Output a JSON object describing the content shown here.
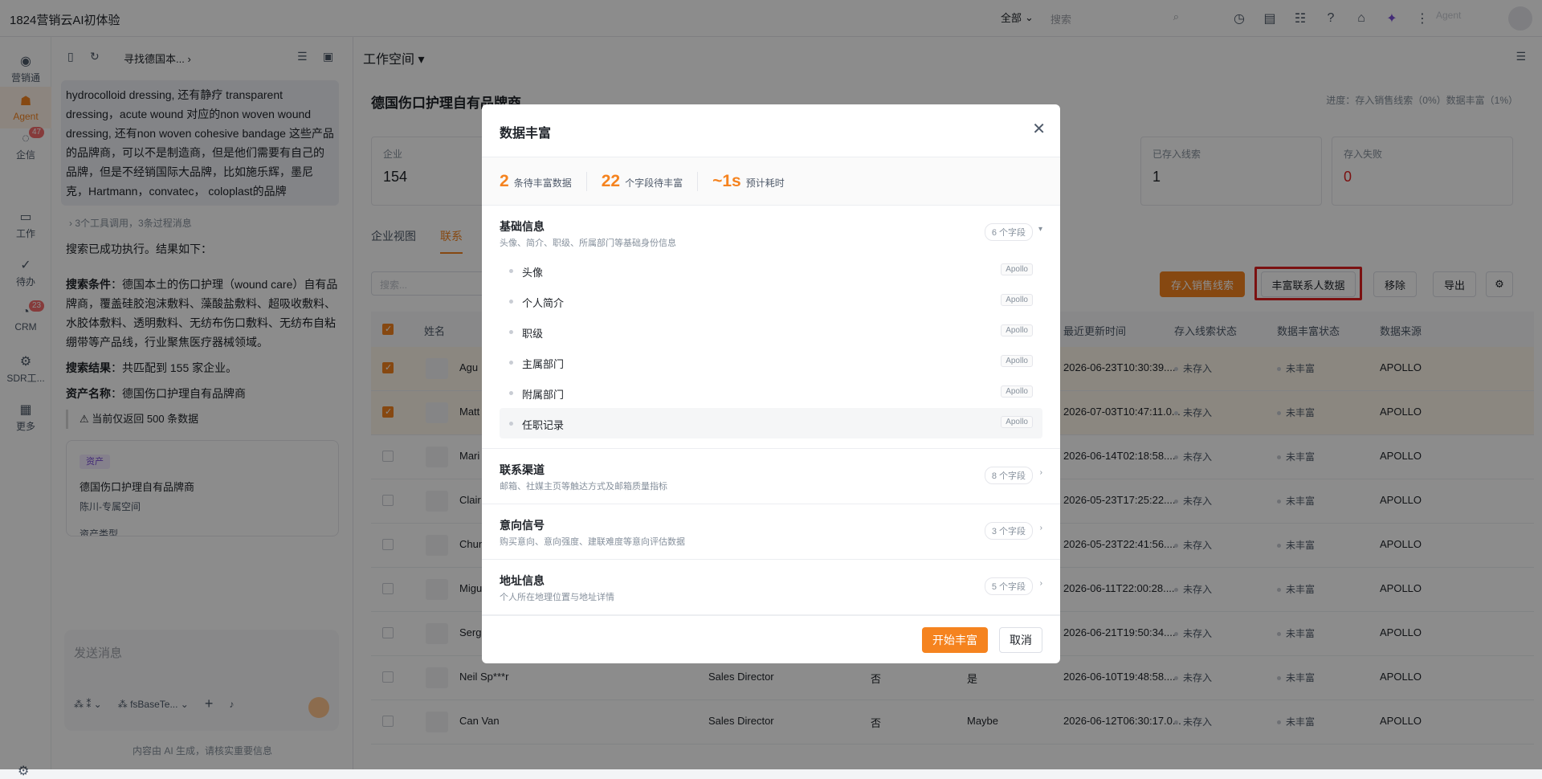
{
  "app": {
    "title": "1824营销云AI初体验",
    "scope": "全部",
    "search_placeholder": "搜索",
    "agent_label": "Agent"
  },
  "rail": [
    {
      "label": "营销通",
      "icon": "broadcast-icon"
    },
    {
      "label": "Agent",
      "icon": "robot-icon"
    },
    {
      "label": "企信",
      "icon": "chat-icon",
      "badge": "47"
    },
    {
      "label": "工作",
      "icon": "briefcase-icon"
    },
    {
      "label": "待办",
      "icon": "check-circle-icon"
    },
    {
      "label": "CRM",
      "icon": "crm-icon",
      "badge": "23"
    },
    {
      "label": "SDR工...",
      "icon": "sdr-icon"
    },
    {
      "label": "更多",
      "icon": "grid-icon"
    }
  ],
  "tooltip": "工作",
  "chat": {
    "breadcrumb": "寻找德国本...",
    "user_msg": "hydrocolloid dressing, 还有静疗 transparent dressing，acute wound 对应的non woven wound dressing, 还有non woven cohesive bandage 这些产品的品牌商，可以不是制造商，但是他们需要有自己的品牌，但是不经销国际大品牌，比如施乐辉，墨尼克，Hartmann，convatec， coloplast的品牌",
    "tool_line": "3个工具调用，3条过程消息",
    "result_intro": "搜索已成功执行。结果如下：",
    "cond_label": "搜索条件",
    "cond_text": "：德国本土的伤口护理（wound care）自有品牌商，覆盖硅胶泡沫敷料、藻酸盐敷料、超吸收敷料、水胶体敷料、透明敷料、无纺布伤口敷料、无纺布自粘绷带等产品线，行业聚焦医疗器械领域。",
    "res_label": "搜索结果",
    "res_text": "：共匹配到 155 家企业。",
    "asset_label": "资产名称",
    "asset_text": "：德国伤口护理自有品牌商",
    "warn": "⚠ 当前仅返回 500 条数据",
    "card": {
      "tag": "资产",
      "title": "德国伤口护理自有品牌商",
      "sub": "陈川-专属空间",
      "extra": "资产类型"
    },
    "input_placeholder": "发送消息",
    "tool_a": "⁂ ⁑",
    "tool_b": "fsBaseTe...",
    "disclaimer": "内容由 AI 生成，请核实重要信息"
  },
  "main": {
    "workspace": "工作空间",
    "title": "德国伤口护理自有品牌商",
    "progress": "进度：存入销售线索（0%）数据丰富（1%）",
    "stats": [
      {
        "label": "企业",
        "value": "154"
      },
      {
        "label": "已存入线索",
        "value": "1"
      },
      {
        "label": "存入失败",
        "value": "0"
      }
    ],
    "tabs": [
      "企业视图",
      "联系"
    ],
    "filter_placeholder": "搜索...",
    "buttons": {
      "save": "存入销售线索",
      "enrich": "丰富联系人数据",
      "remove": "移除",
      "export": "导出"
    },
    "columns": {
      "name": "姓名",
      "updated": "最近更新时间",
      "save_status": "存入线索状态",
      "enrich_status": "数据丰富状态",
      "source": "数据来源"
    },
    "rows": [
      {
        "name": "Agu",
        "title": "",
        "c1": "",
        "c2": "",
        "time": "2026-06-23T10:30:39....",
        "save": "未存入",
        "enrich": "未丰富",
        "src": "APOLLO",
        "checked": true
      },
      {
        "name": "Matt",
        "title": "",
        "c1": "",
        "c2": "",
        "time": "2026-07-03T10:47:11.0...",
        "save": "未存入",
        "enrich": "未丰富",
        "src": "APOLLO",
        "checked": true
      },
      {
        "name": "Mari",
        "title": "",
        "c1": "",
        "c2": "",
        "time": "2026-06-14T02:18:58....",
        "save": "未存入",
        "enrich": "未丰富",
        "src": "APOLLO",
        "checked": false
      },
      {
        "name": "Clair",
        "title": "",
        "c1": "",
        "c2": "",
        "time": "2026-05-23T17:25:22....",
        "save": "未存入",
        "enrich": "未丰富",
        "src": "APOLLO",
        "checked": false
      },
      {
        "name": "Chun",
        "title": "",
        "c1": "",
        "c2": "",
        "time": "2026-05-23T22:41:56....",
        "save": "未存入",
        "enrich": "未丰富",
        "src": "APOLLO",
        "checked": false
      },
      {
        "name": "Migu",
        "title": "",
        "c1": "",
        "c2": "",
        "time": "2026-06-11T22:00:28....",
        "save": "未存入",
        "enrich": "未丰富",
        "src": "APOLLO",
        "checked": false
      },
      {
        "name": "Serg",
        "title": "",
        "c1": "",
        "c2": "",
        "time": "2026-06-21T19:50:34....",
        "save": "未存入",
        "enrich": "未丰富",
        "src": "APOLLO",
        "checked": false
      },
      {
        "name": "Neil Sp***r",
        "title": "Sales Director",
        "c1": "否",
        "c2": "是",
        "time": "2026-06-10T19:48:58....",
        "save": "未存入",
        "enrich": "未丰富",
        "src": "APOLLO",
        "checked": false
      },
      {
        "name": "Can Van",
        "title": "Sales Director",
        "c1": "否",
        "c2": "Maybe",
        "time": "2026-06-12T06:30:17.0...",
        "save": "未存入",
        "enrich": "未丰富",
        "src": "APOLLO",
        "checked": false
      }
    ]
  },
  "modal": {
    "title": "数据丰富",
    "stats": [
      {
        "value": "2",
        "label": "条待丰富数据"
      },
      {
        "value": "22",
        "label": "个字段待丰富"
      },
      {
        "value": "~1s",
        "label": "预计耗时"
      }
    ],
    "sections": [
      {
        "title": "基础信息",
        "desc": "头像、简介、职级、所属部门等基础身份信息",
        "count": "6 个字段",
        "arrow": "▾",
        "fields": [
          "头像",
          "个人简介",
          "职级",
          "主属部门",
          "附属部门",
          "任职记录"
        ],
        "source": "Apollo"
      },
      {
        "title": "联系渠道",
        "desc": "邮箱、社媒主页等触达方式及邮箱质量指标",
        "count": "8 个字段",
        "arrow": "›"
      },
      {
        "title": "意向信号",
        "desc": "购买意向、意向强度、建联难度等意向评估数据",
        "count": "3 个字段",
        "arrow": "›"
      },
      {
        "title": "地址信息",
        "desc": "个人所在地理位置与地址详情",
        "count": "5 个字段",
        "arrow": "›"
      }
    ],
    "start": "开始丰富",
    "cancel": "取消"
  },
  "colors": {
    "accent": "#f5831f",
    "highlight": "#e02020"
  }
}
